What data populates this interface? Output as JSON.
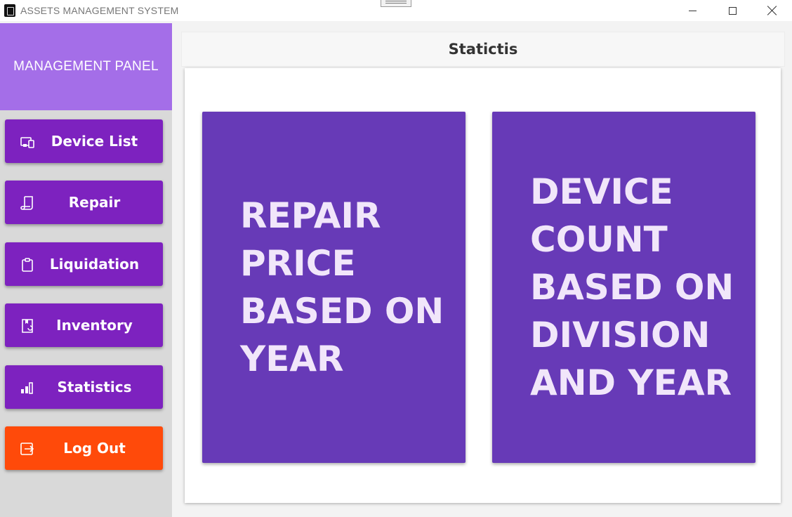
{
  "window": {
    "title": "ASSETS MANAGEMENT SYSTEM"
  },
  "sidebar": {
    "header": "MANAGEMENT PANEL",
    "items": [
      {
        "label": "Device List",
        "icon": "devices-icon"
      },
      {
        "label": "Repair",
        "icon": "receipt-icon"
      },
      {
        "label": "Liquidation",
        "icon": "clipboard-icon"
      },
      {
        "label": "Inventory",
        "icon": "inventory-icon"
      },
      {
        "label": "Statistics",
        "icon": "bar-chart-icon"
      },
      {
        "label": "Log Out",
        "icon": "logout-icon"
      }
    ]
  },
  "main": {
    "title": "Statictis",
    "tiles": [
      {
        "label": "REPAIR PRICE BASED ON YEAR"
      },
      {
        "label": "DEVICE COUNT BASED ON DIVISION AND YEAR"
      }
    ]
  },
  "colors": {
    "panel_header": "#a46ee8",
    "nav_button": "#7d22bf",
    "logout_button": "#ff4a0a",
    "tile": "#673ab7",
    "tile_text": "#f1e6fa"
  }
}
